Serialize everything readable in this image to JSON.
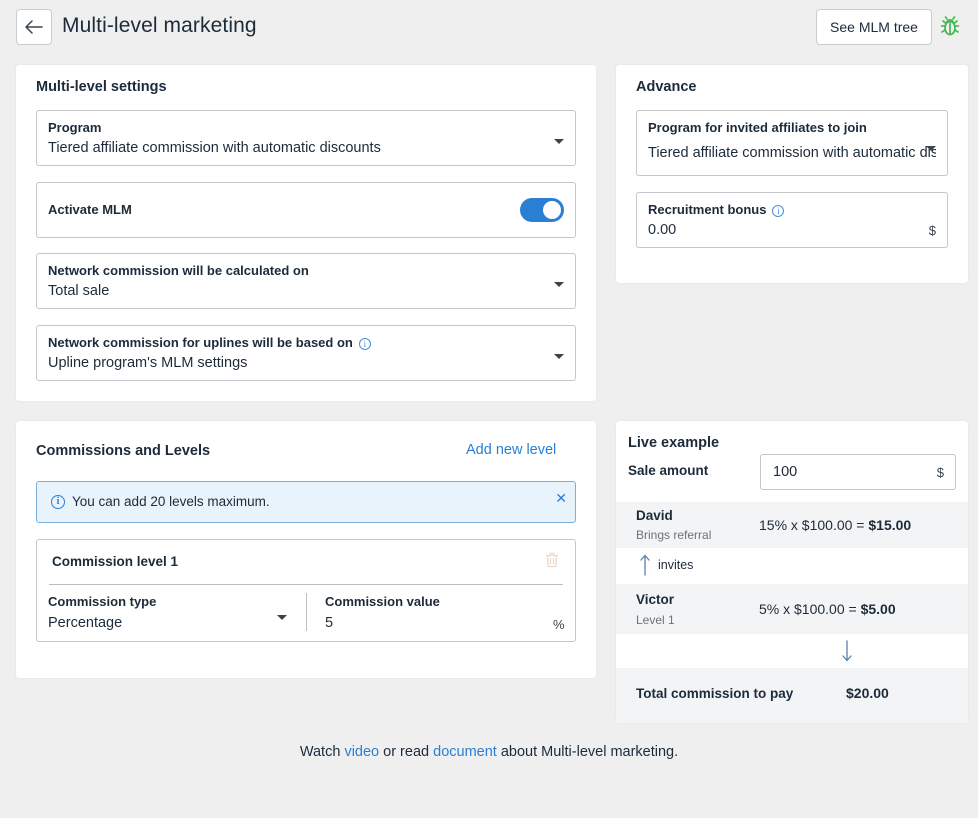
{
  "header": {
    "title": "Multi-level marketing",
    "see_tree_label": "See MLM tree"
  },
  "settings": {
    "title": "Multi-level settings",
    "program_label": "Program",
    "program_value": "Tiered affiliate commission with automatic discounts",
    "activate_label": "Activate MLM",
    "activate_on": true,
    "calc_label": "Network commission will be calculated on",
    "calc_value": "Total sale",
    "upline_label": "Network commission for uplines will be based on",
    "upline_value": "Upline program's MLM settings"
  },
  "advance": {
    "title": "Advance",
    "invite_label": "Program for invited affiliates to join",
    "invite_value": "Tiered affiliate commission with automatic discounts",
    "bonus_label": "Recruitment bonus",
    "bonus_value": "0.00",
    "bonus_unit": "$"
  },
  "levels": {
    "title": "Commissions and Levels",
    "add_label": "Add new level",
    "alert": "You can add 20 levels maximum.",
    "level_title": "Commission level 1",
    "type_label": "Commission type",
    "type_value": "Percentage",
    "value_label": "Commission value",
    "value_value": "5",
    "value_unit": "%"
  },
  "example": {
    "title": "Live example",
    "sale_label": "Sale amount",
    "sale_value": "100",
    "sale_unit": "$",
    "david_name": "David",
    "david_sub": "Brings referral",
    "david_calc": "15% x $100.00 =",
    "david_total": "$15.00",
    "invites_label": "invites",
    "victor_name": "Victor",
    "victor_sub": "Level 1",
    "victor_calc": "5% x $100.00 =",
    "victor_total": "$5.00",
    "total_label": "Total commission to pay",
    "total_value": "$20.00"
  },
  "footer": {
    "watch": "Watch",
    "video": "video",
    "or_read": "or read",
    "document": "document",
    "about": "about Multi-level marketing."
  },
  "colors": {
    "accent": "#2a7fd4",
    "background": "#efefef",
    "bug_icon": "#3bb54a"
  }
}
